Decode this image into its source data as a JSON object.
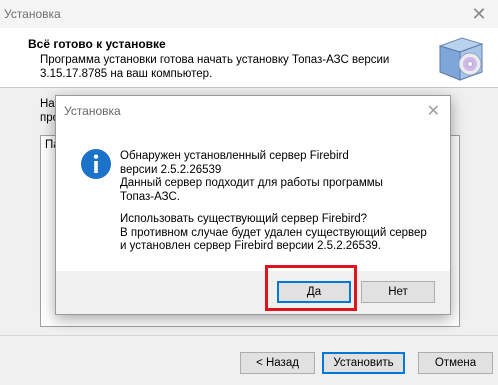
{
  "window": {
    "title": "Установка",
    "close_symbol": "✕"
  },
  "header": {
    "title": "Всё готово к установке",
    "subtitle_line1": "Программа установки готова начать установку Топаз-АЗС версии",
    "subtitle_line2": "3.15.17.8785 на ваш компьютер.",
    "icon": "installer-box-icon"
  },
  "background": {
    "text_line1": "Наж",
    "text_line2": "прог",
    "panel_text": "Па"
  },
  "buttons": {
    "back": "< Назад",
    "install": "Установить",
    "cancel": "Отмена"
  },
  "dialog": {
    "title": "Установка",
    "close_symbol": "✕",
    "icon": "info-icon",
    "lines1": [
      "Обнаружен установленный сервер Firebird",
      "версии 2.5.2.26539",
      "Данный сервер подходит для работы программы",
      "Топаз-АЗС."
    ],
    "lines2": [
      "Использовать существующий сервер Firebird?",
      "В противном случае будет удален существующий сервер",
      "и установлен сервер Firebird версии 2.5.2.26539."
    ],
    "yes_label": "Да",
    "no_label": "Нет"
  },
  "colors": {
    "accent": "#0078d7",
    "highlight": "#e1141e",
    "info_icon": "#1a73c9"
  }
}
